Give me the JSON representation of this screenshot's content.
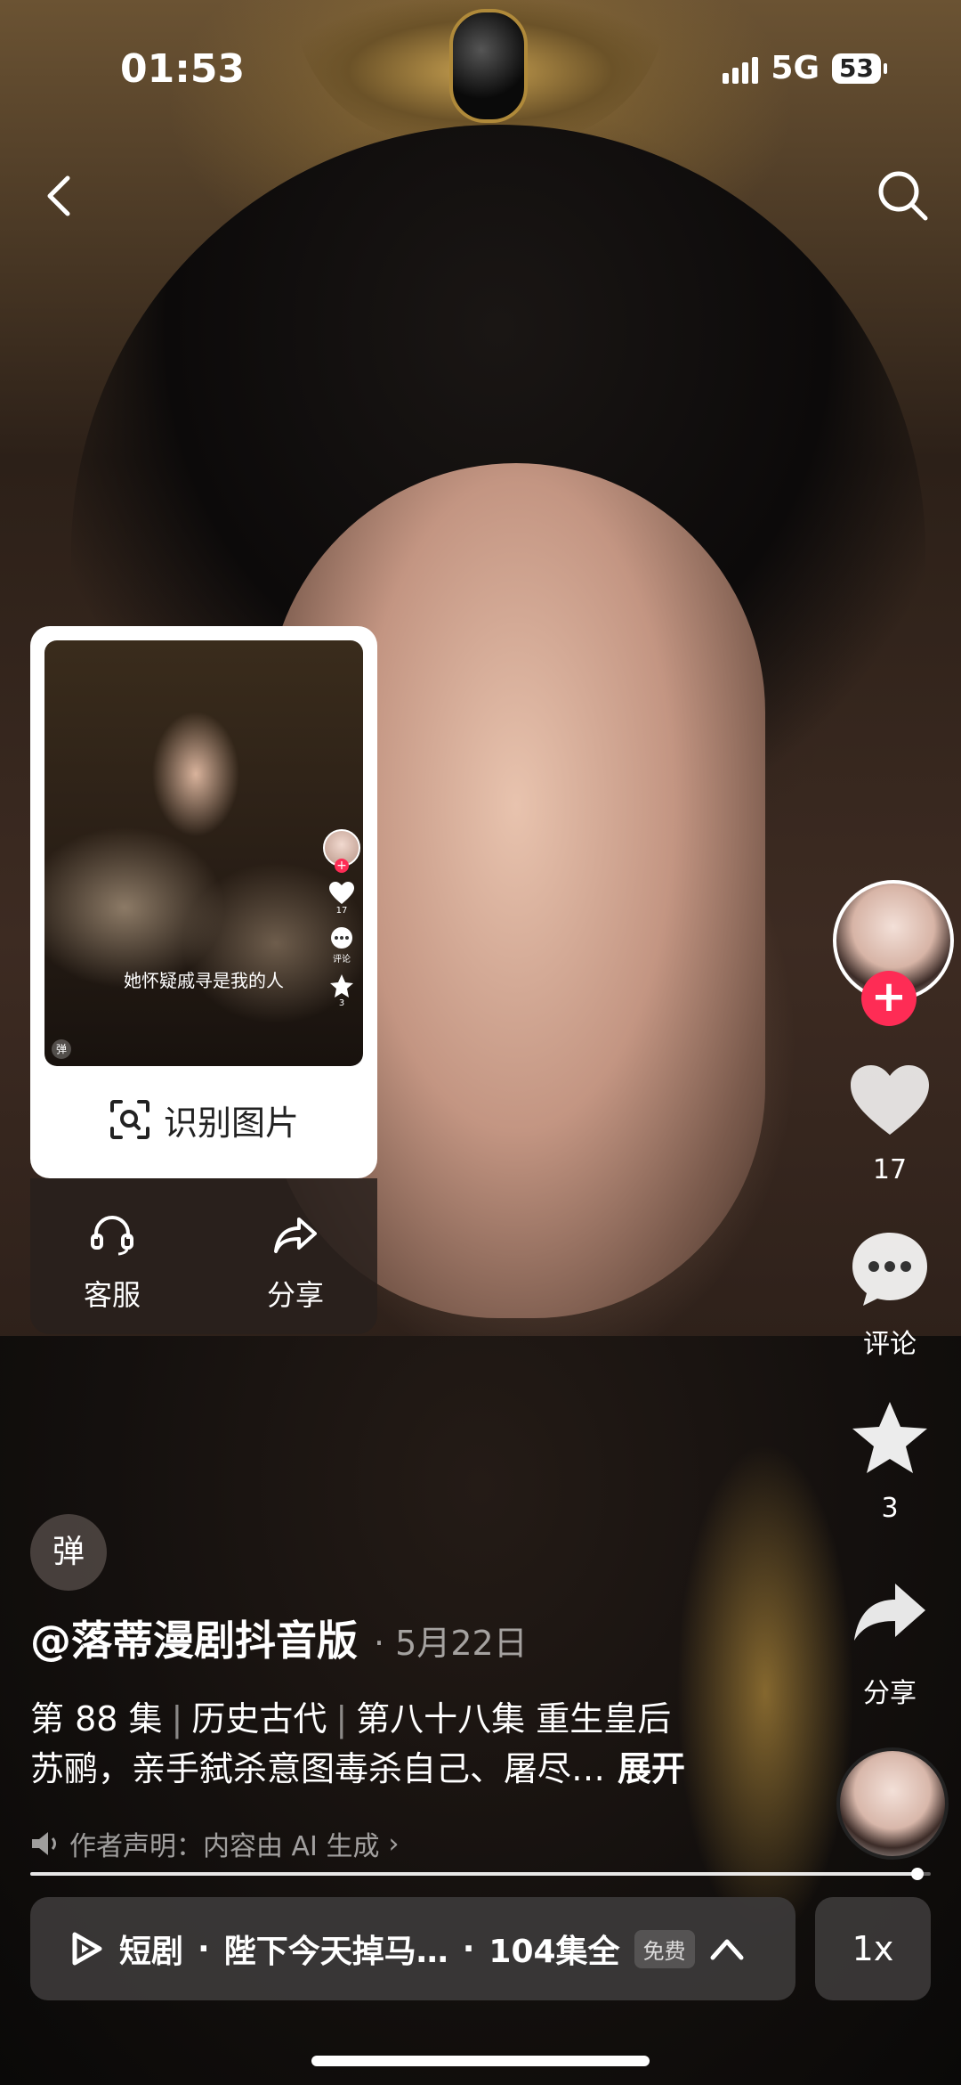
{
  "status_bar": {
    "time": "01:53",
    "network": "5G",
    "battery": "53"
  },
  "popup": {
    "thumbnail_caption": "她怀疑戚寻是我的人",
    "thumbnail_like_count": "17",
    "thumbnail_comment_label": "评论",
    "thumbnail_star_count": "3",
    "thumbnail_dan_label": "弹",
    "recognize_label": "识别图片",
    "customer_service_label": "客服",
    "share_label": "分享"
  },
  "sidebar": {
    "like_count": "17",
    "comment_label": "评论",
    "favorite_count": "3",
    "share_label": "分享"
  },
  "video_info": {
    "danmaku_label": "弹",
    "author": "@落蒂漫剧抖音版",
    "date": "· 5月22日",
    "episode": "第 88 集",
    "category": "历史古代",
    "description_line1": "第八十八集 重生皇后",
    "description_line2": "苏鹂，亲手弑杀意图毒杀自己、屠尽…",
    "expand_label": "展开",
    "ai_note": "作者声明：内容由 AI 生成",
    "progress": 0.985
  },
  "bottom_bar": {
    "series_prefix": "短剧",
    "series_dot": "·",
    "series_title": "陛下今天掉马…",
    "episodes_dot": "·",
    "episodes": "104集全",
    "free_badge": "免费",
    "speed": "1x"
  },
  "colors": {
    "accent": "#fe2c55"
  }
}
